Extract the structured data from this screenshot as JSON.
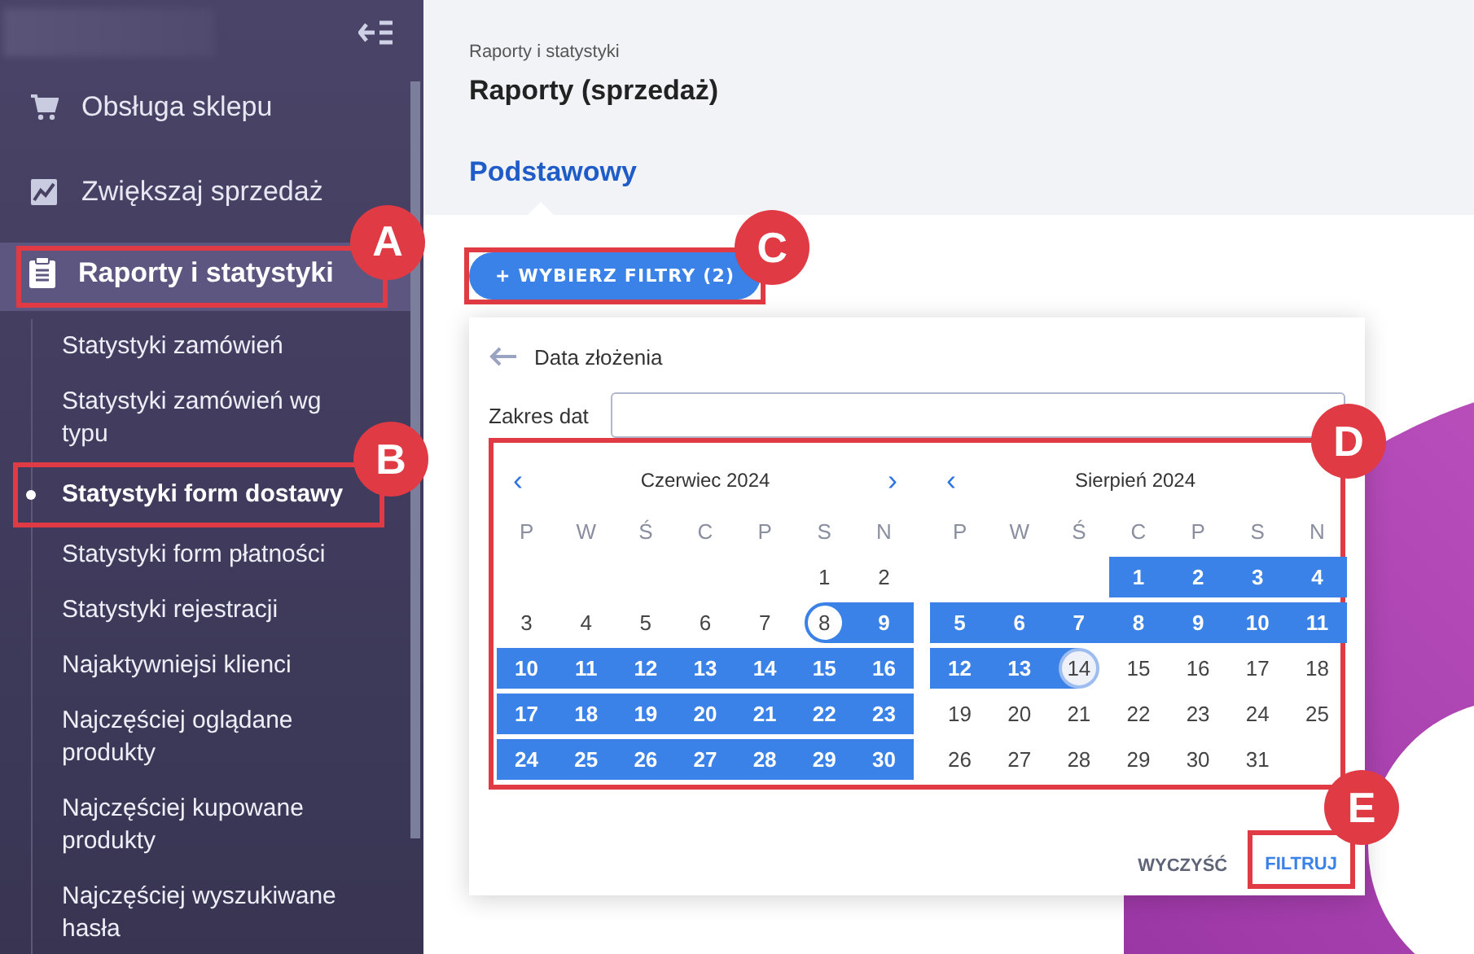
{
  "sidebar": {
    "items": [
      {
        "label": "Obsługa sklepu",
        "selected": false
      },
      {
        "label": "Zwiększaj sprzedaż",
        "selected": false
      },
      {
        "label": "Raporty i statystyki",
        "selected": true,
        "callout": "A"
      }
    ],
    "subitems": [
      {
        "label": "Statystyki zamówień",
        "selected": false
      },
      {
        "label": "Statystyki zamówień wg typu",
        "selected": false
      },
      {
        "label": "Statystyki form dostawy",
        "selected": true,
        "callout": "B"
      },
      {
        "label": "Statystyki form płatności",
        "selected": false
      },
      {
        "label": "Statystyki rejestracji",
        "selected": false
      },
      {
        "label": "Najaktywniejsi klienci",
        "selected": false
      },
      {
        "label": "Najczęściej oglądane produkty",
        "selected": false
      },
      {
        "label": "Najczęściej kupowane produkty",
        "selected": false
      },
      {
        "label": "Najczęściej wyszukiwane hasła",
        "selected": false
      }
    ]
  },
  "breadcrumb": "Raporty i statystyki",
  "title": "Raporty (sprzedaż)",
  "tabs": [
    {
      "label": "Podstawowy",
      "selected": true
    }
  ],
  "filter_button": {
    "label": "+ WYBIERZ FILTRY (2)",
    "callout": "C"
  },
  "filter_panel": {
    "title": "Data złożenia",
    "field_label": "Zakres dat",
    "callout": "D",
    "calendars": [
      {
        "month": "Czerwiec 2024",
        "prev": "‹",
        "next": "›",
        "weekdays": [
          "P",
          "W",
          "Ś",
          "C",
          "P",
          "S",
          "N"
        ],
        "weeks": [
          [
            {
              "kind": "blank"
            },
            {
              "kind": "blank"
            },
            {
              "kind": "blank"
            },
            {
              "kind": "blank"
            },
            {
              "kind": "blank"
            },
            {
              "kind": "day",
              "day": "1",
              "selected": false,
              "in_range": false
            },
            {
              "kind": "day",
              "day": "2",
              "selected": false,
              "in_range": false
            }
          ],
          [
            {
              "kind": "day",
              "day": "3",
              "selected": false,
              "in_range": false
            },
            {
              "kind": "day",
              "day": "4",
              "selected": false,
              "in_range": false
            },
            {
              "kind": "day",
              "day": "5",
              "selected": false,
              "in_range": false
            },
            {
              "kind": "day",
              "day": "6",
              "selected": false,
              "in_range": false
            },
            {
              "kind": "day",
              "day": "7",
              "selected": false,
              "in_range": false
            },
            {
              "kind": "day",
              "day": "8",
              "selected": true,
              "in_range": false
            },
            {
              "kind": "day",
              "day": "9",
              "selected": false,
              "in_range": true
            }
          ],
          [
            {
              "kind": "day",
              "day": "10",
              "selected": false,
              "in_range": true
            },
            {
              "kind": "day",
              "day": "11",
              "selected": false,
              "in_range": true
            },
            {
              "kind": "day",
              "day": "12",
              "selected": false,
              "in_range": true
            },
            {
              "kind": "day",
              "day": "13",
              "selected": false,
              "in_range": true
            },
            {
              "kind": "day",
              "day": "14",
              "selected": false,
              "in_range": true
            },
            {
              "kind": "day",
              "day": "15",
              "selected": false,
              "in_range": true
            },
            {
              "kind": "day",
              "day": "16",
              "selected": false,
              "in_range": true
            }
          ],
          [
            {
              "kind": "day",
              "day": "17",
              "selected": false,
              "in_range": true
            },
            {
              "kind": "day",
              "day": "18",
              "selected": false,
              "in_range": true
            },
            {
              "kind": "day",
              "day": "19",
              "selected": false,
              "in_range": true
            },
            {
              "kind": "day",
              "day": "20",
              "selected": false,
              "in_range": true
            },
            {
              "kind": "day",
              "day": "21",
              "selected": false,
              "in_range": true
            },
            {
              "kind": "day",
              "day": "22",
              "selected": false,
              "in_range": true
            },
            {
              "kind": "day",
              "day": "23",
              "selected": false,
              "in_range": true
            }
          ],
          [
            {
              "kind": "day",
              "day": "24",
              "selected": false,
              "in_range": true
            },
            {
              "kind": "day",
              "day": "25",
              "selected": false,
              "in_range": true
            },
            {
              "kind": "day",
              "day": "26",
              "selected": false,
              "in_range": true
            },
            {
              "kind": "day",
              "day": "27",
              "selected": false,
              "in_range": true
            },
            {
              "kind": "day",
              "day": "28",
              "selected": false,
              "in_range": true
            },
            {
              "kind": "day",
              "day": "29",
              "selected": false,
              "in_range": true
            },
            {
              "kind": "day",
              "day": "30",
              "selected": false,
              "in_range": true
            }
          ]
        ]
      },
      {
        "month": "Sierpień 2024",
        "prev": "‹",
        "weekdays": [
          "P",
          "W",
          "Ś",
          "C",
          "P",
          "S",
          "N"
        ],
        "weeks": [
          [
            {
              "kind": "blank"
            },
            {
              "kind": "blank"
            },
            {
              "kind": "blank"
            },
            {
              "kind": "day",
              "day": "1",
              "selected": false,
              "in_range": true
            },
            {
              "kind": "day",
              "day": "2",
              "selected": false,
              "in_range": true
            },
            {
              "kind": "day",
              "day": "3",
              "selected": false,
              "in_range": true
            },
            {
              "kind": "day",
              "day": "4",
              "selected": false,
              "in_range": true
            }
          ],
          [
            {
              "kind": "day",
              "day": "5",
              "selected": false,
              "in_range": true
            },
            {
              "kind": "day",
              "day": "6",
              "selected": false,
              "in_range": true
            },
            {
              "kind": "day",
              "day": "7",
              "selected": false,
              "in_range": true
            },
            {
              "kind": "day",
              "day": "8",
              "selected": false,
              "in_range": true
            },
            {
              "kind": "day",
              "day": "9",
              "selected": false,
              "in_range": true
            },
            {
              "kind": "day",
              "day": "10",
              "selected": false,
              "in_range": true
            },
            {
              "kind": "day",
              "day": "11",
              "selected": false,
              "in_range": true
            }
          ],
          [
            {
              "kind": "day",
              "day": "12",
              "selected": false,
              "in_range": true
            },
            {
              "kind": "day",
              "day": "13",
              "selected": false,
              "in_range": true
            },
            {
              "kind": "day",
              "day": "14",
              "selected": true,
              "in_range": false
            },
            {
              "kind": "day",
              "day": "15",
              "selected": false,
              "in_range": false
            },
            {
              "kind": "day",
              "day": "16",
              "selected": false,
              "in_range": false
            },
            {
              "kind": "day",
              "day": "17",
              "selected": false,
              "in_range": false
            },
            {
              "kind": "day",
              "day": "18",
              "selected": false,
              "in_range": false
            }
          ],
          [
            {
              "kind": "day",
              "day": "19",
              "selected": false,
              "in_range": false
            },
            {
              "kind": "day",
              "day": "20",
              "selected": false,
              "in_range": false
            },
            {
              "kind": "day",
              "day": "21",
              "selected": false,
              "in_range": false
            },
            {
              "kind": "day",
              "day": "22",
              "selected": false,
              "in_range": false
            },
            {
              "kind": "day",
              "day": "23",
              "selected": false,
              "in_range": false
            },
            {
              "kind": "day",
              "day": "24",
              "selected": false,
              "in_range": false
            },
            {
              "kind": "day",
              "day": "25",
              "selected": false,
              "in_range": false
            }
          ],
          [
            {
              "kind": "day",
              "day": "26",
              "selected": false,
              "in_range": false
            },
            {
              "kind": "day",
              "day": "27",
              "selected": false,
              "in_range": false
            },
            {
              "kind": "day",
              "day": "28",
              "selected": false,
              "in_range": false
            },
            {
              "kind": "day",
              "day": "29",
              "selected": false,
              "in_range": false
            },
            {
              "kind": "day",
              "day": "30",
              "selected": false,
              "in_range": false
            },
            {
              "kind": "day",
              "day": "31",
              "selected": false,
              "in_range": false
            },
            {
              "kind": "blank"
            }
          ]
        ]
      }
    ],
    "actions": [
      {
        "label": "WYCZYŚĆ",
        "kind": "secondary"
      },
      {
        "label": "FILTRUJ",
        "kind": "primary",
        "callout": "E"
      }
    ]
  }
}
